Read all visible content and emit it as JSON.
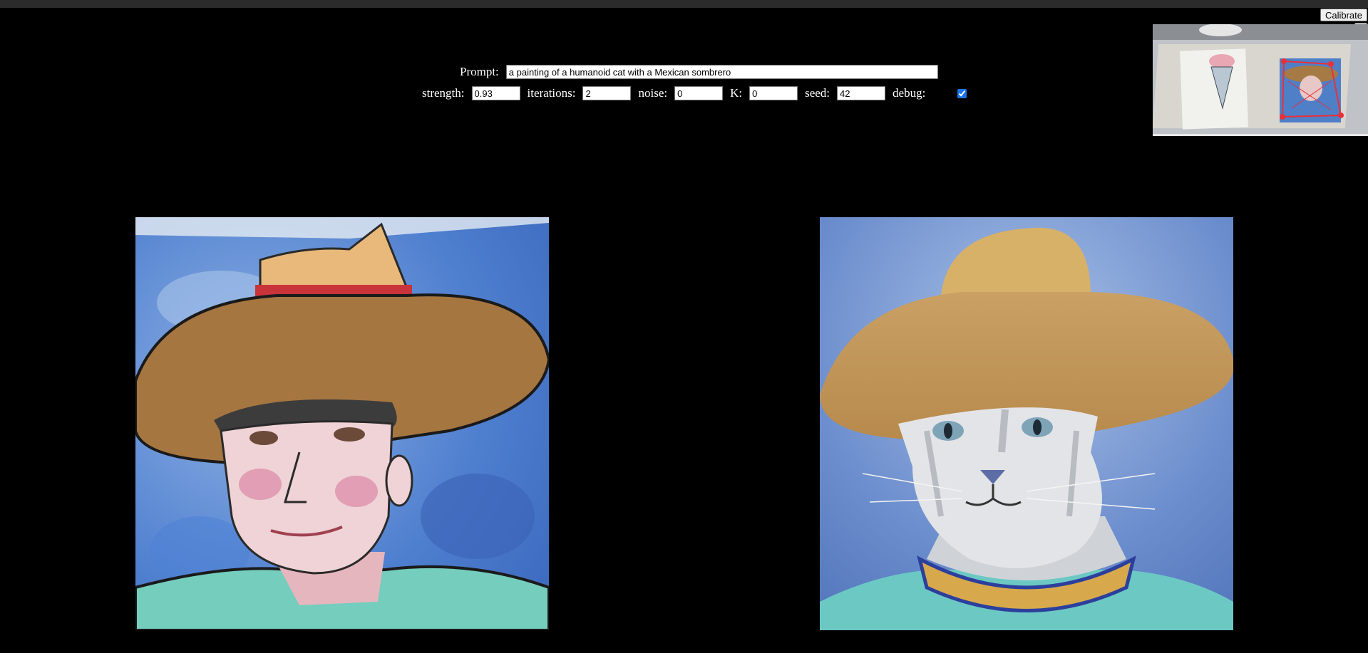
{
  "controls": {
    "prompt_label": "Prompt:",
    "prompt_value": "a painting of a humanoid cat with a Mexican sombrero",
    "strength_label": "strength:",
    "strength_value": "0.93",
    "iterations_label": "iterations:",
    "iterations_value": "2",
    "noise_label": "noise:",
    "noise_value": "0",
    "k_label": "K:",
    "k_value": "0",
    "seed_label": "seed:",
    "seed_value": "42",
    "debug_label": "debug:",
    "debug_checked": true
  },
  "buttons": {
    "calibrate_label": "Calibrate",
    "help_label": "?"
  },
  "colors": {
    "background": "#000000",
    "topbar": "#2b2b2b",
    "sky_blue": "#5f87c8",
    "hat_brown": "#a57a45",
    "shirt_teal": "#63c4b7"
  }
}
